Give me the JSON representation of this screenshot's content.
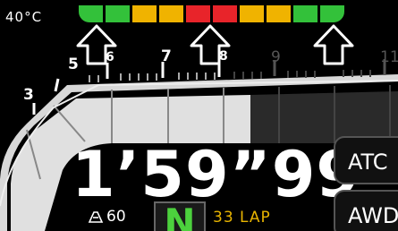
{
  "status": {
    "temperature": "40°C"
  },
  "shift_lights": {
    "colors": [
      "#33c13a",
      "#33c13a",
      "#f0b300",
      "#f0b300",
      "#e8242a",
      "#e8242a",
      "#f0b300",
      "#f0b300",
      "#33c13a",
      "#33c13a"
    ]
  },
  "shift_arrows": {
    "icon": "shift-up-arrow-icon"
  },
  "rpm_gauge": {
    "tick_labels": [
      "3",
      "5",
      "6",
      "7",
      "8",
      "9",
      "11"
    ],
    "active_color": "#e0e0e0",
    "inactive_color": "#2a2a2a"
  },
  "timing": {
    "lap_time": "1’59”99"
  },
  "buttons": {
    "atc_label": "ATC",
    "awd_label": "AWD"
  },
  "fuel": {
    "icon": "fuel-icon",
    "value": "60"
  },
  "gear": {
    "value": "N"
  },
  "laps": {
    "label": "33 LAP"
  }
}
